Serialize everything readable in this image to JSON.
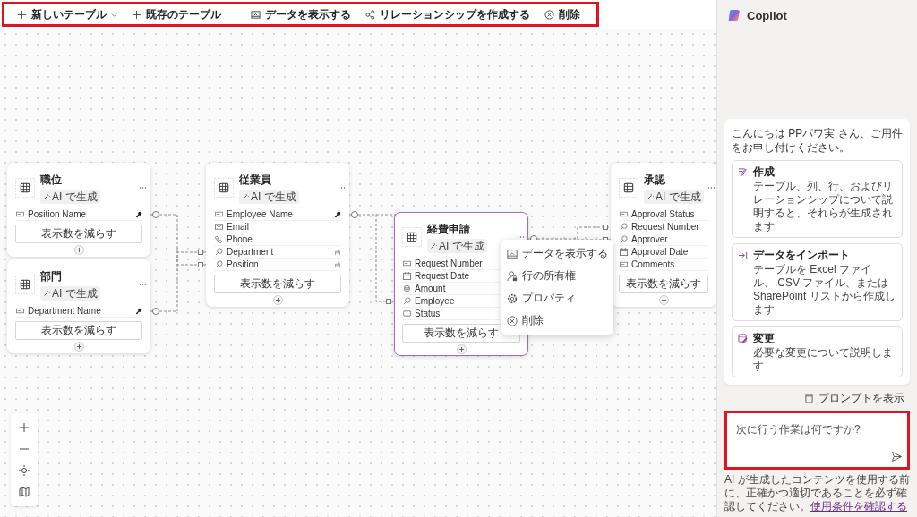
{
  "toolbar": {
    "create_items": [
      {
        "label": "新しいテーブル",
        "dropdown": true
      },
      {
        "label": "既存のテーブル",
        "dropdown": false
      }
    ],
    "action_items": [
      {
        "kind": "view",
        "label": "データを表示する"
      },
      {
        "kind": "relation",
        "label": "リレーションシップを作成する"
      },
      {
        "kind": "delete",
        "label": "削除"
      }
    ]
  },
  "tables": [
    {
      "name": "職位",
      "tag": "AI で生成",
      "selected": false,
      "show_less": "表示数を減らす",
      "fields": [
        {
          "kind": "text",
          "name": "Position Name",
          "primary": true
        }
      ]
    },
    {
      "name": "部門",
      "tag": "AI で生成",
      "selected": false,
      "show_less": "表示数を減らす",
      "fields": [
        {
          "kind": "text",
          "name": "Department Name",
          "primary": true
        }
      ]
    },
    {
      "name": "従業員",
      "tag": "AI で生成",
      "selected": false,
      "show_less": "表示数を減らす",
      "fields": [
        {
          "kind": "text",
          "name": "Employee Name",
          "primary": true
        },
        {
          "kind": "email",
          "name": "Email",
          "primary": false
        },
        {
          "kind": "phone",
          "name": "Phone",
          "primary": false
        },
        {
          "kind": "lookup",
          "name": "Department",
          "primary": false
        },
        {
          "kind": "lookup",
          "name": "Position",
          "primary": false
        }
      ]
    },
    {
      "name": "経費申請",
      "tag": "AI で生成",
      "selected": true,
      "show_less": "表示数を減らす",
      "fields": [
        {
          "kind": "text",
          "name": "Request Number",
          "primary": false
        },
        {
          "kind": "date",
          "name": "Request Date",
          "primary": false
        },
        {
          "kind": "currency",
          "name": "Amount",
          "primary": false
        },
        {
          "kind": "lookup",
          "name": "Employee",
          "primary": false
        },
        {
          "kind": "choice",
          "name": "Status",
          "primary": false
        }
      ]
    },
    {
      "name": "承認",
      "tag": "AI で生成",
      "selected": false,
      "show_less": "表示数を減らす",
      "fields": [
        {
          "kind": "text",
          "name": "Approval Status",
          "primary": false
        },
        {
          "kind": "lookup",
          "name": "Request Number",
          "primary": false
        },
        {
          "kind": "lookup",
          "name": "Approver",
          "primary": false
        },
        {
          "kind": "date",
          "name": "Approval Date",
          "primary": false
        },
        {
          "kind": "text",
          "name": "Comments",
          "primary": false
        }
      ]
    }
  ],
  "context_menu": [
    {
      "kind": "view",
      "label": "データを表示する"
    },
    {
      "kind": "ownership",
      "label": "行の所有権"
    },
    {
      "kind": "properties",
      "label": "プロパティ"
    },
    {
      "kind": "delete",
      "label": "削除"
    }
  ],
  "copilot": {
    "title": "Copilot",
    "greeting": "こんにちは PPパワ実 さん、ご用件をお申し付けください。",
    "suggestions": [
      {
        "kind": "create",
        "title": "作成",
        "description": "テーブル、列、行、およびリレーションシップについて説明すると、それらが生成されます"
      },
      {
        "kind": "import",
        "title": "データをインポート",
        "description": "テーブルを Excel ファイル、.CSV ファイル、または SharePoint リストから作成します"
      },
      {
        "kind": "edit",
        "title": "変更",
        "description": "必要な変更について説明します"
      }
    ],
    "show_prompts": "プロンプトを表示",
    "input": {
      "placeholder": "次に行う作業は何ですか?"
    },
    "disclaimer": {
      "text": "AI が生成したコンテンツを使用する前に、正確かつ適切であることを必ず確認してください。",
      "link": "使用条件を確認する"
    }
  }
}
